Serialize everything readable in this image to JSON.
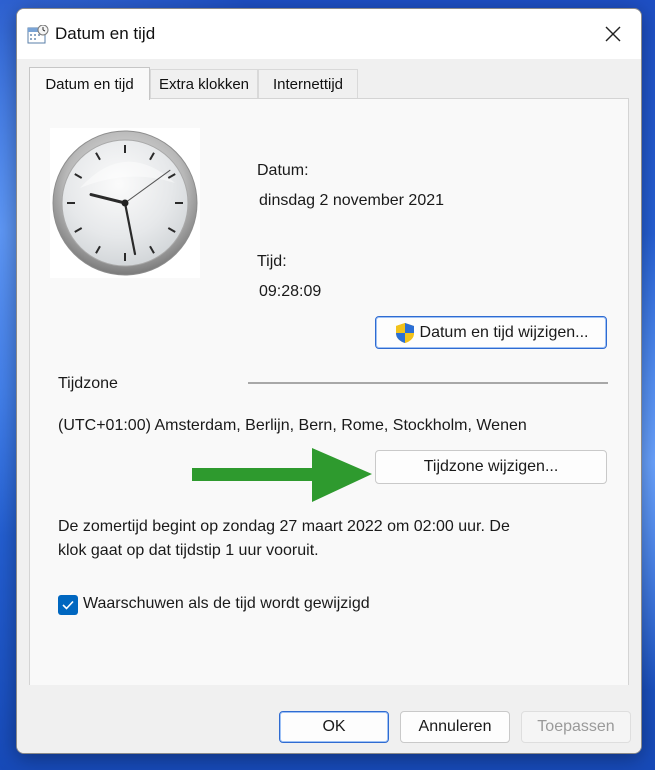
{
  "window": {
    "title": "Datum en tijd",
    "close_icon": "close-icon"
  },
  "tabs": [
    {
      "label": "Datum en tijd",
      "active": true
    },
    {
      "label": "Extra klokken",
      "active": false
    },
    {
      "label": "Internettijd",
      "active": false
    }
  ],
  "date_section": {
    "date_label": "Datum:",
    "date_value": "dinsdag 2 november 2021",
    "time_label": "Tijd:",
    "time_value": "09:28:09",
    "change_button": "Datum en tijd wijzigen..."
  },
  "clock": {
    "hours": 9,
    "minutes": 28,
    "seconds": 9
  },
  "timezone_section": {
    "heading": "Tijdzone",
    "value": "(UTC+01:00) Amsterdam, Berlijn, Bern, Rome, Stockholm, Wenen",
    "change_button": "Tijdzone wijzigen..."
  },
  "dst_notice": {
    "line1": "De zomertijd begint op zondag 27 maart 2022 om 02:00 uur. De",
    "line2": "klok gaat op dat tijdstip 1 uur vooruit."
  },
  "notify_checkbox": {
    "label": "Waarschuwen als de tijd wordt gewijzigd",
    "checked": true
  },
  "footer": {
    "ok": "OK",
    "cancel": "Annuleren",
    "apply": "Toepassen"
  },
  "colors": {
    "accent": "#0067c0",
    "annotation_arrow": "#2e9a2e"
  }
}
